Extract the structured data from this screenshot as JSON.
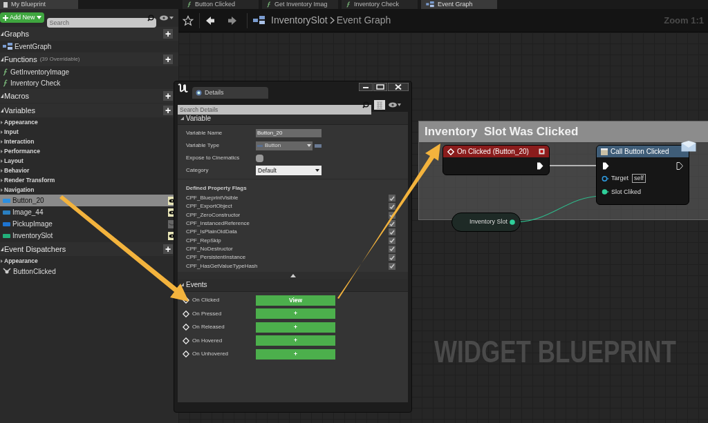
{
  "left_tab": {
    "label": "My Blueprint"
  },
  "toolbar": {
    "add_button": "Add New",
    "search_placeholder": "Search"
  },
  "tree": [
    {
      "kind": "section",
      "label": "Graphs",
      "add": "+"
    },
    {
      "kind": "graph_item",
      "label": "EventGraph",
      "selected": false
    },
    {
      "kind": "section",
      "label": "Functions",
      "note": "(39 Overridable)",
      "add": "+"
    },
    {
      "kind": "function_item",
      "label": "GetInventoryImage",
      "selected": false
    },
    {
      "kind": "function_item",
      "label": "Inventory Check",
      "selected": false
    },
    {
      "kind": "section",
      "label": "Macros",
      "add": "+"
    },
    {
      "kind": "section",
      "label": "Variables",
      "add": "+"
    },
    {
      "kind": "category",
      "label": "Appearance"
    },
    {
      "kind": "category",
      "label": "Input"
    },
    {
      "kind": "category",
      "label": "Interaction"
    },
    {
      "kind": "category",
      "label": "Performance"
    },
    {
      "kind": "category",
      "label": "Layout"
    },
    {
      "kind": "category",
      "label": "Behavior"
    },
    {
      "kind": "category",
      "label": "Render Transform"
    },
    {
      "kind": "category",
      "label": "Navigation"
    },
    {
      "kind": "variable",
      "label": "Button_20",
      "color": "#2b8fe0",
      "selected": true,
      "visible": true
    },
    {
      "kind": "variable",
      "label": "Image_44",
      "color": "#2a7fc0",
      "selected": false,
      "visible": true
    },
    {
      "kind": "variable",
      "label": "PickupImage",
      "color": "#1e74d0",
      "selected": false,
      "visible": false
    },
    {
      "kind": "variable",
      "label": "InventorySlot",
      "color": "#22b07a",
      "selected": false,
      "visible": true
    },
    {
      "kind": "section",
      "label": "Event Dispatchers",
      "add": "+"
    },
    {
      "kind": "category",
      "label": "Appearance"
    },
    {
      "kind": "dispatcher_item",
      "label": "ButtonClicked",
      "selected": false
    }
  ],
  "graph_tabs": [
    {
      "label": "Button Clicked",
      "kind": "function",
      "selected": false
    },
    {
      "label": "Get Inventory Imag",
      "kind": "function",
      "selected": false
    },
    {
      "label": "Inventory Check",
      "kind": "function",
      "selected": false
    },
    {
      "label": "Event Graph",
      "kind": "graph",
      "selected": true
    }
  ],
  "breadcrumb": [
    "InventorySlot",
    "Event Graph"
  ],
  "zoom": "Zoom 1:1",
  "details": {
    "tab": "Details",
    "search_placeholder": "Search Details",
    "variable_section": "Variable",
    "properties": [
      {
        "kind": "text",
        "label": "Variable Name",
        "value": "Button_20"
      },
      {
        "kind": "type",
        "label": "Variable Type",
        "value": "Button"
      },
      {
        "kind": "checkbox",
        "label": "Expose to Cinematics",
        "checked": false
      },
      {
        "kind": "dropdown",
        "label": "Category",
        "value": "Default"
      }
    ],
    "flags_title": "Defined Property Flags",
    "flags": [
      {
        "label": "CPF_BlueprintVisible",
        "checked": true
      },
      {
        "label": "CPF_ExportObject",
        "checked": true
      },
      {
        "label": "CPF_ZeroConstructor",
        "checked": true
      },
      {
        "label": "CPF_InstancedReference",
        "checked": true
      },
      {
        "label": "CPF_IsPlainOldData",
        "checked": true
      },
      {
        "label": "CPF_RepSkip",
        "checked": true
      },
      {
        "label": "CPF_NoDestructor",
        "checked": true
      },
      {
        "label": "CPF_PersistentInstance",
        "checked": true
      },
      {
        "label": "CPF_HasGetValueTypeHash",
        "checked": true
      }
    ],
    "events_section": "Events",
    "events": [
      {
        "label": "On Clicked",
        "button": "View"
      },
      {
        "label": "On Pressed",
        "button": "+"
      },
      {
        "label": "On Released",
        "button": "+"
      },
      {
        "label": "On Hovered",
        "button": "+"
      },
      {
        "label": "On Unhovered",
        "button": "+"
      }
    ]
  },
  "graph": {
    "comment": "Inventory  Slot Was Clicked",
    "event_node": {
      "title": "On Clicked (Button_20)"
    },
    "function_node": {
      "title": "Call Button Clicked",
      "pins": [
        {
          "kind": "object",
          "label": "Target",
          "default": "self"
        },
        {
          "kind": "data",
          "label": "Slot Cliked"
        }
      ]
    },
    "variable_node": {
      "label": "Inventory Slot"
    },
    "watermark": "WIDGET BLUEPRINT"
  }
}
